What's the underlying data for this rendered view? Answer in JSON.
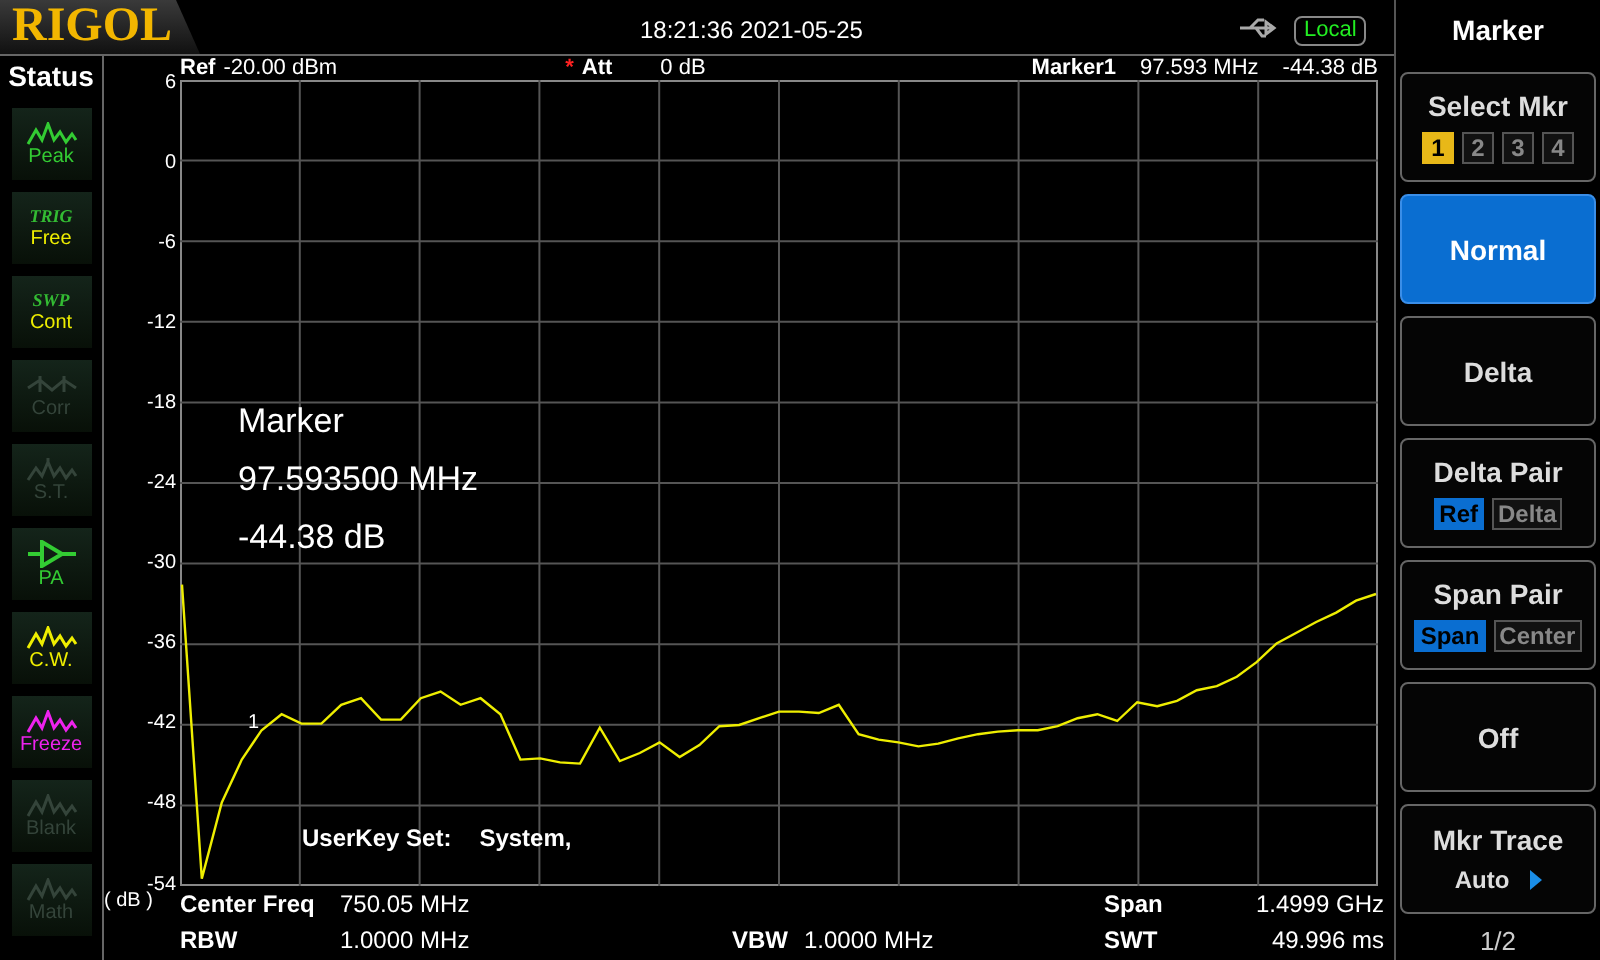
{
  "header": {
    "logo": "RIGOL",
    "datetime": "18:21:36 2021-05-25",
    "remote_badge": "Local"
  },
  "status": {
    "title": "Status",
    "items": [
      {
        "kind": "peak",
        "label": "Peak",
        "color": "#33cc33"
      },
      {
        "kind": "tag",
        "tag": "TRIG",
        "label": "Free",
        "color": "#eeee00"
      },
      {
        "kind": "tag",
        "tag": "SWP",
        "label": "Cont",
        "color": "#eeee00"
      },
      {
        "kind": "corr",
        "label": "Corr",
        "color": "#34443a"
      },
      {
        "kind": "st",
        "label": "S.T.",
        "color": "#34443a"
      },
      {
        "kind": "amp",
        "label": "PA",
        "color": "#33cc33"
      },
      {
        "kind": "wave",
        "label": "C.W.",
        "color": "#eeee00"
      },
      {
        "kind": "wave",
        "label": "Freeze",
        "color": "#ee22ee"
      },
      {
        "kind": "wave",
        "label": "Blank",
        "color": "#34443a"
      },
      {
        "kind": "wave",
        "label": "Math",
        "color": "#34443a"
      }
    ]
  },
  "trace_info": {
    "ref_label": "Ref",
    "ref_value": "-20.00 dBm",
    "att_flag": "*",
    "att_label": "Att",
    "att_value": "0 dB",
    "marker_label": "Marker1",
    "marker_freq": "97.593 MHz",
    "marker_amp": "-44.38 dB"
  },
  "y_axis_unit": "( dB )",
  "plot": {
    "chart_data": {
      "type": "line",
      "grid": true,
      "ylim": [
        -54,
        6
      ],
      "yticks": [
        {
          "value": 6,
          "label": "6"
        },
        {
          "value": 0,
          "label": "0"
        },
        {
          "value": -6,
          "label": "-6"
        },
        {
          "value": -12,
          "label": "-12"
        },
        {
          "value": -18,
          "label": "-18"
        },
        {
          "value": -24,
          "label": "-24"
        },
        {
          "value": -30,
          "label": "-30"
        },
        {
          "value": -36,
          "label": "-36"
        },
        {
          "value": -42,
          "label": "-42"
        },
        {
          "value": -48,
          "label": "-48"
        },
        {
          "value": -54,
          "label": "-54"
        }
      ],
      "categories": [
        null,
        null,
        null,
        null,
        null,
        null,
        null,
        null,
        null,
        null,
        null,
        null,
        null,
        null,
        null,
        null,
        null,
        null,
        null,
        null,
        null,
        null,
        null,
        null,
        null,
        null,
        null,
        null,
        null,
        null,
        null,
        null,
        null,
        null,
        null,
        null,
        null,
        null,
        null,
        null,
        null,
        null,
        null,
        null,
        null,
        null,
        null,
        null,
        null,
        null,
        null,
        null,
        null,
        null,
        null,
        null,
        null,
        null,
        null,
        null,
        null
      ],
      "series": [
        {
          "color": "#eeee00",
          "values": [
            -31.6,
            -53.6,
            -47.9,
            -44.7,
            -42.5,
            -41.3,
            -42.0,
            -42.0,
            -40.6,
            -40.1,
            -41.7,
            -41.7,
            -40.1,
            -39.6,
            -40.6,
            -40.1,
            -41.3,
            -44.7,
            -44.6,
            -44.9,
            -45.0,
            -42.3,
            -44.8,
            -44.2,
            -43.4,
            -44.5,
            -43.6,
            -42.2,
            -42.1,
            -41.6,
            -41.1,
            -41.1,
            -41.2,
            -40.6,
            -42.8,
            -43.2,
            -43.4,
            -43.7,
            -43.5,
            -43.1,
            -42.8,
            -42.6,
            -42.5,
            -42.5,
            -42.2,
            -41.6,
            -41.3,
            -41.8,
            -40.4,
            -40.7,
            -40.3,
            -39.5,
            -39.2,
            -38.5,
            -37.4,
            -36.0,
            -35.2,
            -34.4,
            -33.7,
            -32.8,
            -32.3
          ]
        }
      ]
    },
    "marker_number": "1",
    "readout": [
      "Marker",
      "97.593500 MHz",
      "-44.38 dB"
    ],
    "userkey_label": "UserKey Set:",
    "userkey_value": "System,"
  },
  "settings": {
    "center_freq_label": "Center Freq",
    "center_freq": "750.05 MHz",
    "span_label": "Span",
    "span": "1.4999 GHz",
    "rbw_label": "RBW",
    "rbw": "1.0000 MHz",
    "vbw_label": "VBW",
    "vbw": "1.0000 MHz",
    "swt_label": "SWT",
    "swt": "49.996 ms"
  },
  "menu": {
    "title": "Marker",
    "items": [
      {
        "kind": "select",
        "label": "Select Mkr",
        "options": [
          {
            "label": "1",
            "selected": true
          },
          {
            "label": "2",
            "selected": false
          },
          {
            "label": "3",
            "selected": false
          },
          {
            "label": "4",
            "selected": false
          }
        ]
      },
      {
        "kind": "button",
        "label": "Normal",
        "selected": true
      },
      {
        "kind": "button",
        "label": "Delta",
        "selected": false
      },
      {
        "kind": "pair",
        "label": "Delta Pair",
        "options": [
          {
            "label": "Ref",
            "selected": true
          },
          {
            "label": "Delta",
            "selected": false
          }
        ]
      },
      {
        "kind": "pair",
        "label": "Span Pair",
        "options": [
          {
            "label": "Span",
            "selected": true
          },
          {
            "label": "Center",
            "selected": false
          }
        ]
      },
      {
        "kind": "button",
        "label": "Off",
        "selected": false
      },
      {
        "kind": "value",
        "label": "Mkr Trace",
        "value": "Auto"
      }
    ],
    "page": "1/2"
  }
}
